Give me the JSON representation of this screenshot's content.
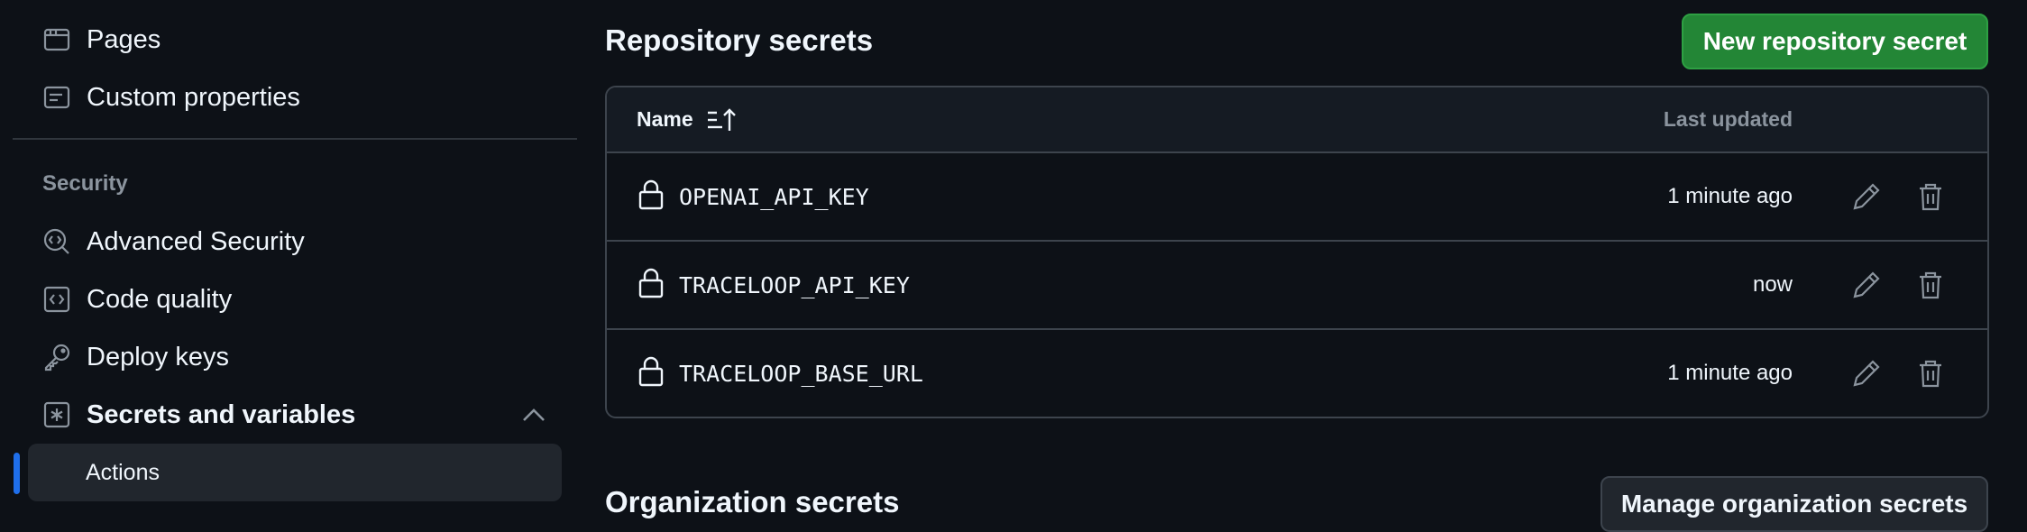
{
  "sidebar": {
    "items_top": [
      {
        "label": "Pages",
        "icon": "browser-icon"
      },
      {
        "label": "Custom properties",
        "icon": "note-icon"
      }
    ],
    "security_heading": "Security",
    "items_security": [
      {
        "label": "Advanced Security",
        "icon": "codescan-icon"
      },
      {
        "label": "Code quality",
        "icon": "code-square-icon"
      },
      {
        "label": "Deploy keys",
        "icon": "key-icon"
      },
      {
        "label": "Secrets and variables",
        "icon": "asterisk-icon",
        "expanded": true
      }
    ],
    "active_subitem": "Actions"
  },
  "repo_secrets": {
    "heading": "Repository secrets",
    "new_button": "New repository secret",
    "col_name": "Name",
    "col_updated": "Last updated",
    "rows": [
      {
        "name": "OPENAI_API_KEY",
        "updated": "1 minute ago"
      },
      {
        "name": "TRACELOOP_API_KEY",
        "updated": "now"
      },
      {
        "name": "TRACELOOP_BASE_URL",
        "updated": "1 minute ago"
      }
    ]
  },
  "org_secrets": {
    "heading": "Organization secrets",
    "manage_button": "Manage organization secrets"
  },
  "colors": {
    "background": "#0d1117",
    "primary_button": "#238636",
    "active_indicator": "#1f6feb",
    "border": "#3d444d",
    "muted_text": "#8b949e"
  }
}
